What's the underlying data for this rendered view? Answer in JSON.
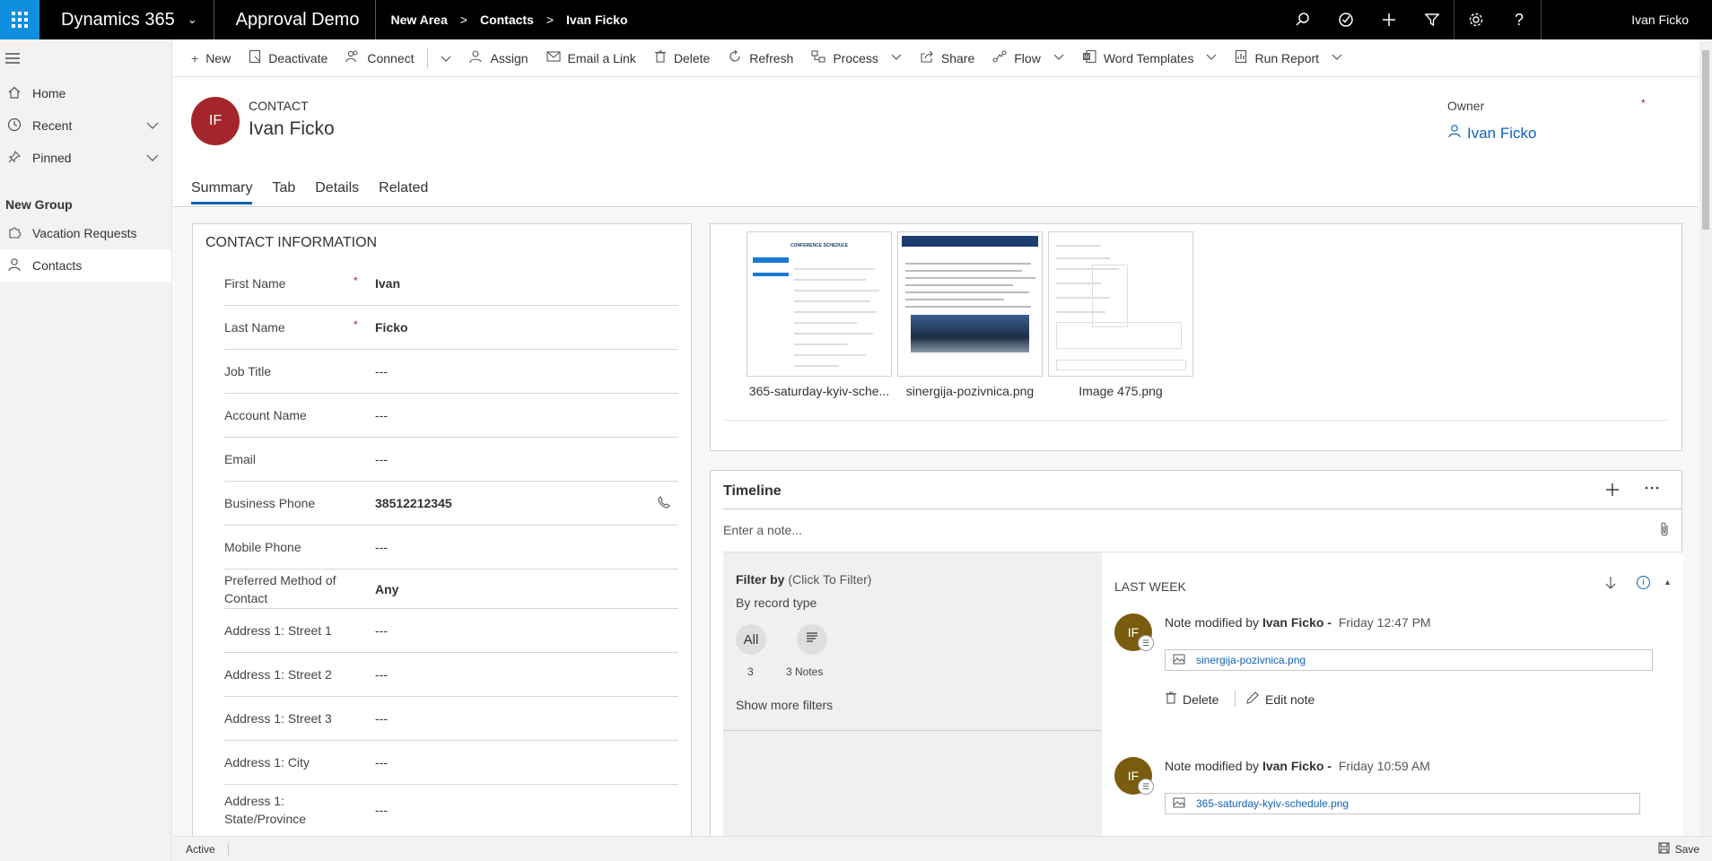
{
  "topbar": {
    "app_name": "Dynamics 365",
    "env_name": "Approval Demo",
    "breadcrumb": [
      "New Area",
      "Contacts",
      "Ivan Ficko"
    ],
    "user_name": "Ivan Ficko"
  },
  "leftnav": {
    "items": [
      {
        "label": "Home",
        "icon": "home-icon"
      },
      {
        "label": "Recent",
        "icon": "clock-icon"
      },
      {
        "label": "Pinned",
        "icon": "pin-icon"
      }
    ],
    "group_label": "New Group",
    "group_items": [
      {
        "label": "Vacation Requests",
        "icon": "puzzle-icon"
      },
      {
        "label": "Contacts",
        "icon": "person-icon"
      }
    ]
  },
  "commands": {
    "new": "New",
    "deactivate": "Deactivate",
    "connect": "Connect",
    "assign": "Assign",
    "email_link": "Email a Link",
    "delete": "Delete",
    "refresh": "Refresh",
    "process": "Process",
    "share": "Share",
    "flow": "Flow",
    "word_templates": "Word Templates",
    "run_report": "Run Report"
  },
  "header": {
    "initials": "IF",
    "entity_type": "CONTACT",
    "entity_name": "Ivan Ficko",
    "owner_label": "Owner",
    "owner_value": "Ivan Ficko",
    "tabs": [
      "Summary",
      "Tab",
      "Details",
      "Related"
    ]
  },
  "contact_info": {
    "title": "CONTACT INFORMATION",
    "fields": [
      {
        "label": "First Name",
        "value": "Ivan"
      },
      {
        "label": "Last Name",
        "value": "Ficko"
      },
      {
        "label": "Job Title",
        "value": "---"
      },
      {
        "label": "Account Name",
        "value": "---"
      },
      {
        "label": "Email",
        "value": "---"
      },
      {
        "label": "Business Phone",
        "value": "38512212345"
      },
      {
        "label": "Mobile Phone",
        "value": "---"
      },
      {
        "label": "Preferred Method of Contact",
        "value": "Any"
      },
      {
        "label": "Address 1: Street 1",
        "value": "---"
      },
      {
        "label": "Address 1: Street 2",
        "value": "---"
      },
      {
        "label": "Address 1: Street 3",
        "value": "---"
      },
      {
        "label": "Address 1: City",
        "value": "---"
      },
      {
        "label": "Address 1: State/Province",
        "value": "---"
      }
    ]
  },
  "attachments": {
    "items": [
      {
        "name": "365-saturday-kyiv-sche...",
        "doc_title": "CONFERENCE SCHEDULE"
      },
      {
        "name": "sinergija-pozivnica.png"
      },
      {
        "name": "Image 475.png"
      }
    ]
  },
  "timeline": {
    "title": "Timeline",
    "note_placeholder": "Enter a note...",
    "filter_by": "Filter by",
    "click_to_filter": "(Click To Filter)",
    "by_record_type": "By record type",
    "all_label": "All",
    "all_count": "3",
    "notes_count": "3 Notes",
    "show_more": "Show more filters",
    "section": "LAST WEEK",
    "entries": [
      {
        "initials": "IF",
        "prefix": "Note modified by",
        "author": "Ivan Ficko -",
        "date": "Friday 12:47 PM",
        "attachment": "sinergija-pozivnica.png",
        "delete_label": "Delete",
        "edit_label": "Edit note"
      },
      {
        "initials": "IF",
        "prefix": "Note modified by",
        "author": "Ivan Ficko -",
        "date": "Friday 10:59 AM",
        "attachment": "365-saturday-kyiv-schedule.png"
      }
    ]
  },
  "status": {
    "state": "Active",
    "save_label": "Save"
  }
}
